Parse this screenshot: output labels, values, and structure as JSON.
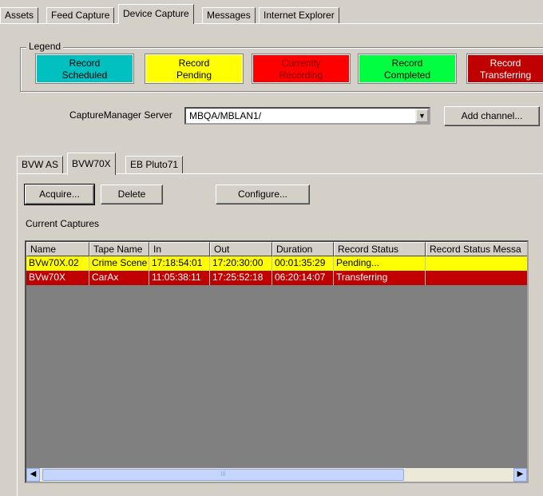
{
  "top_tabs": [
    "Assets",
    "Feed Capture",
    "Device Capture",
    "Messages",
    "Internet Explorer"
  ],
  "legend": {
    "title": "Legend",
    "items": [
      {
        "line1": "Record",
        "line2": "Scheduled",
        "color": "#00c0c0",
        "text_color": "#000000"
      },
      {
        "line1": "Record",
        "line2": "Pending",
        "color": "#ffff00",
        "text_color": "#000000"
      },
      {
        "line1": "Currently",
        "line2": "Recording",
        "color": "#ff0000",
        "text_color": "#800000"
      },
      {
        "line1": "Record",
        "line2": "Completed",
        "color": "#00ff40",
        "text_color": "#000000"
      },
      {
        "line1": "Record",
        "line2": "Transferring",
        "color": "#c00000",
        "text_color": "#ffffff"
      }
    ]
  },
  "server": {
    "label": "CaptureManager Server",
    "value": "MBQA/MBLAN1/",
    "add_channel": "Add channel..."
  },
  "channel_tabs": [
    "BVW AS",
    "BVW70X",
    "EB Pluto71"
  ],
  "toolbar": {
    "acquire": "Acquire...",
    "delete": "Delete",
    "configure": "Configure..."
  },
  "current_captures_label": "Current Captures",
  "table": {
    "columns": [
      "Name",
      "Tape Name",
      "In",
      "Out",
      "Duration",
      "Record Status",
      "Record Status Messa"
    ],
    "rows": [
      {
        "cells": [
          "BVw70X.02",
          "Crime Scene",
          "17:18:54:01",
          "17:20:30:00",
          "00:01:35:29",
          "Pending...",
          ""
        ],
        "status": "yellow"
      },
      {
        "cells": [
          "BVw70X",
          "CarAx",
          "11:05:38:11",
          "17:25:52:18",
          "06:20:14:07",
          "Transferring",
          ""
        ],
        "status": "red"
      }
    ]
  },
  "scrollbar": {
    "thumb_grip": "III"
  }
}
